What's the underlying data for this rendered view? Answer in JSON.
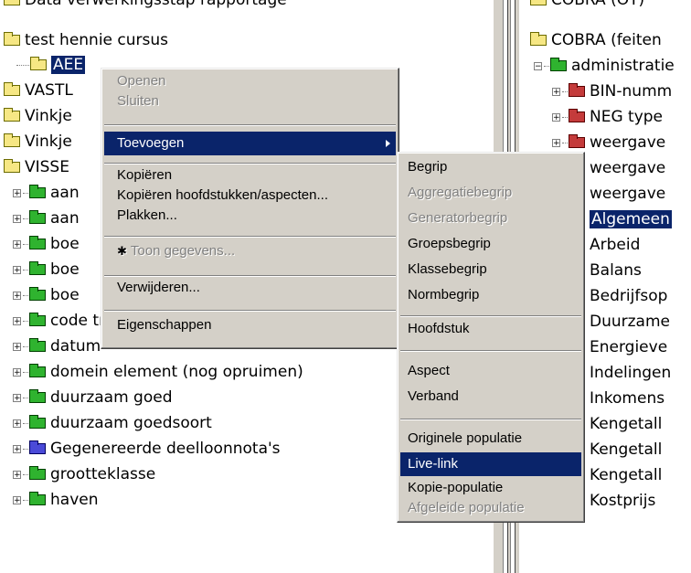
{
  "left_tree": {
    "items": [
      {
        "label": "Data verwerkingsstap rapportage",
        "icon": "folder-icon"
      },
      {
        "label": "test hennie cursus",
        "icon": "folder-icon"
      },
      {
        "label": "AEE",
        "icon": "folder-open-icon"
      },
      {
        "label": "VASTL",
        "icon": "folder-icon"
      },
      {
        "label": "Vinkje",
        "icon": "folder-icon"
      },
      {
        "label": "Vinkje",
        "icon": "folder-icon"
      },
      {
        "label": "VISSE",
        "icon": "folder-icon"
      },
      {
        "label": "aan",
        "icon": "green-folder-icon"
      },
      {
        "label": "aan",
        "icon": "green-folder-icon"
      },
      {
        "label": "boe",
        "icon": "green-folder-icon"
      },
      {
        "label": "boe",
        "icon": "green-folder-icon"
      },
      {
        "label": "boe",
        "icon": "green-folder-icon"
      },
      {
        "label": "code transactievoorkomen",
        "icon": "green-folder-icon"
      },
      {
        "label": "datum",
        "icon": "green-folder-icon"
      },
      {
        "label": "domein element (nog opruimen)",
        "icon": "green-folder-icon"
      },
      {
        "label": "duurzaam goed",
        "icon": "green-folder-icon"
      },
      {
        "label": "duurzaam goedsoort",
        "icon": "green-folder-icon"
      },
      {
        "label": "Gegenereerde deelloonnota's",
        "icon": "blue-folder-icon"
      },
      {
        "label": "grootteklasse",
        "icon": "green-folder-icon"
      },
      {
        "label": "haven",
        "icon": "green-folder-icon"
      }
    ]
  },
  "right_tree": {
    "items": [
      {
        "label": "COBRA (OT)",
        "icon": "folder-icon"
      },
      {
        "label": "COBRA (feiten",
        "icon": "folder-icon"
      },
      {
        "label": "administratie",
        "icon": "green-folder-icon"
      },
      {
        "label": "BIN-numm",
        "icon": "red-folder-icon"
      },
      {
        "label": "NEG type",
        "icon": "red-folder-icon"
      },
      {
        "label": "weergave",
        "icon": "red-folder-icon"
      },
      {
        "label": "weergave",
        "icon": "red-folder-icon"
      },
      {
        "label": "weergave",
        "icon": "red-folder-icon"
      },
      {
        "label": "Algemeen",
        "icon": "green-folder-icon"
      },
      {
        "label": "Arbeid",
        "icon": "green-folder-icon"
      },
      {
        "label": "Balans",
        "icon": "green-folder-icon"
      },
      {
        "label": "Bedrijfsop",
        "icon": "green-folder-icon"
      },
      {
        "label": "Duurzame",
        "icon": "green-folder-icon"
      },
      {
        "label": "Energieve",
        "icon": "green-folder-icon"
      },
      {
        "label": "Indelingen",
        "icon": "green-folder-icon"
      },
      {
        "label": "Inkomens",
        "icon": "green-folder-icon"
      },
      {
        "label": "Kengetall",
        "icon": "green-folder-icon"
      },
      {
        "label": "Kengetall",
        "icon": "green-folder-icon"
      },
      {
        "label": "Kengetall",
        "icon": "green-folder-icon"
      },
      {
        "label": "Kostprijs",
        "icon": "green-folder-icon"
      }
    ]
  },
  "context_menu": {
    "open": "Openen",
    "close": "Sluiten",
    "add": "Toevoegen",
    "copy": "Kopiëren",
    "copy_chapters": "Kopiëren hoofdstukken/aspecten...",
    "paste": "Plakken...",
    "show_data": "Toon gegevens...",
    "delete": "Verwijderen...",
    "properties": "Eigenschappen"
  },
  "submenu": {
    "concept": "Begrip",
    "aggregate": "Aggregatiebegrip",
    "generator": "Generatorbegrip",
    "group": "Groepsbegrip",
    "class": "Klassebegrip",
    "norm": "Normbegrip",
    "chapter": "Hoofdstuk",
    "aspect": "Aspect",
    "relation": "Verband",
    "original_population": "Originele populatie",
    "live_link": "Live-link",
    "copy_population": "Kopie-populatie",
    "derived_population": "Afgeleide populatie"
  },
  "colors": {
    "selection": "#0a246a",
    "menu_bg": "#d4d0c8",
    "folder_yellow": "#f6e784",
    "folder_green": "#2fb32f",
    "folder_red": "#c43b3b",
    "folder_blue": "#4a4ad8"
  }
}
